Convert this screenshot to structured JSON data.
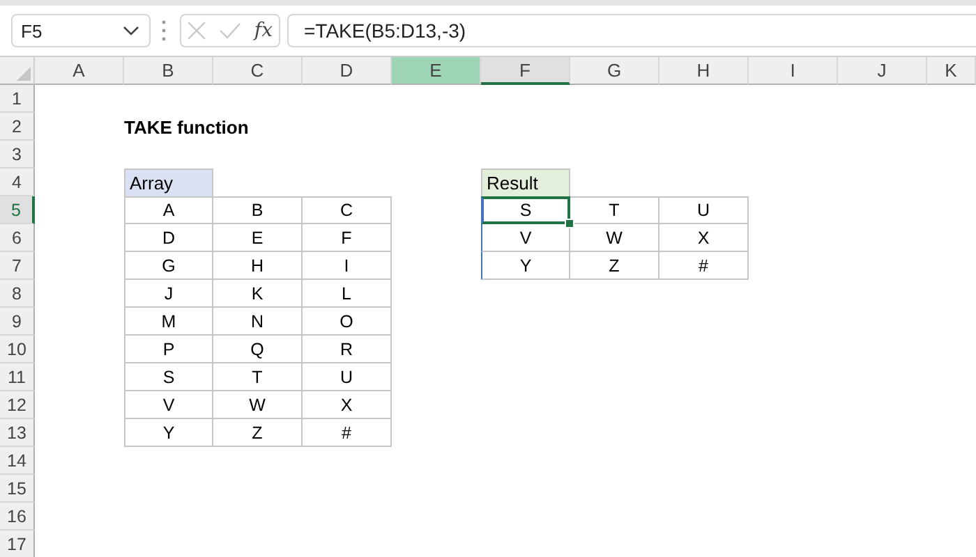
{
  "formula_bar": {
    "name_box": "F5",
    "function_button": "fx",
    "formula": "=TAKE(B5:D13,-3)"
  },
  "columns": [
    {
      "label": "A",
      "selected": false,
      "highlighted": false
    },
    {
      "label": "B",
      "selected": false,
      "highlighted": false
    },
    {
      "label": "C",
      "selected": false,
      "highlighted": false
    },
    {
      "label": "D",
      "selected": false,
      "highlighted": false
    },
    {
      "label": "E",
      "selected": false,
      "highlighted": true
    },
    {
      "label": "F",
      "selected": true,
      "highlighted": false
    },
    {
      "label": "G",
      "selected": false,
      "highlighted": false
    },
    {
      "label": "H",
      "selected": false,
      "highlighted": false
    },
    {
      "label": "I",
      "selected": false,
      "highlighted": false
    },
    {
      "label": "J",
      "selected": false,
      "highlighted": false
    },
    {
      "label": "K",
      "selected": false,
      "highlighted": false
    }
  ],
  "rows": [
    {
      "label": "1",
      "selected": false
    },
    {
      "label": "2",
      "selected": false
    },
    {
      "label": "3",
      "selected": false
    },
    {
      "label": "4",
      "selected": false
    },
    {
      "label": "5",
      "selected": true
    },
    {
      "label": "6",
      "selected": false
    },
    {
      "label": "7",
      "selected": false
    },
    {
      "label": "8",
      "selected": false
    },
    {
      "label": "9",
      "selected": false
    },
    {
      "label": "10",
      "selected": false
    },
    {
      "label": "11",
      "selected": false
    },
    {
      "label": "12",
      "selected": false
    },
    {
      "label": "13",
      "selected": false
    },
    {
      "label": "14",
      "selected": false
    },
    {
      "label": "15",
      "selected": false
    },
    {
      "label": "16",
      "selected": false
    },
    {
      "label": "17",
      "selected": false
    }
  ],
  "title": "TAKE function",
  "array_table": {
    "header": "Array",
    "rows": [
      [
        {
          "text": "A",
          "selected": false
        },
        {
          "text": "B",
          "selected": false
        },
        {
          "text": "C",
          "selected": false
        }
      ],
      [
        {
          "text": "D",
          "selected": false
        },
        {
          "text": "E",
          "selected": false
        },
        {
          "text": "F",
          "selected": false
        }
      ],
      [
        {
          "text": "G",
          "selected": false
        },
        {
          "text": "H",
          "selected": false
        },
        {
          "text": "I",
          "selected": false
        }
      ],
      [
        {
          "text": "J",
          "selected": false
        },
        {
          "text": "K",
          "selected": false
        },
        {
          "text": "L",
          "selected": false
        }
      ],
      [
        {
          "text": "M",
          "selected": false
        },
        {
          "text": "N",
          "selected": false
        },
        {
          "text": "O",
          "selected": false
        }
      ],
      [
        {
          "text": "P",
          "selected": false
        },
        {
          "text": "Q",
          "selected": false
        },
        {
          "text": "R",
          "selected": false
        }
      ],
      [
        {
          "text": "S",
          "selected": false
        },
        {
          "text": "T",
          "selected": false
        },
        {
          "text": "U",
          "selected": false
        }
      ],
      [
        {
          "text": "V",
          "selected": false
        },
        {
          "text": "W",
          "selected": false
        },
        {
          "text": "X",
          "selected": false
        }
      ],
      [
        {
          "text": "Y",
          "selected": false
        },
        {
          "text": "Z",
          "selected": false
        },
        {
          "text": "#",
          "selected": false
        }
      ]
    ]
  },
  "result_table": {
    "header": "Result",
    "rows": [
      [
        {
          "text": "S",
          "selected": true
        },
        {
          "text": "T",
          "selected": false
        },
        {
          "text": "U",
          "selected": false
        }
      ],
      [
        {
          "text": "V",
          "selected": false
        },
        {
          "text": "W",
          "selected": false
        },
        {
          "text": "X",
          "selected": false
        }
      ],
      [
        {
          "text": "Y",
          "selected": false
        },
        {
          "text": "Z",
          "selected": false
        },
        {
          "text": "#",
          "selected": false
        }
      ]
    ]
  }
}
